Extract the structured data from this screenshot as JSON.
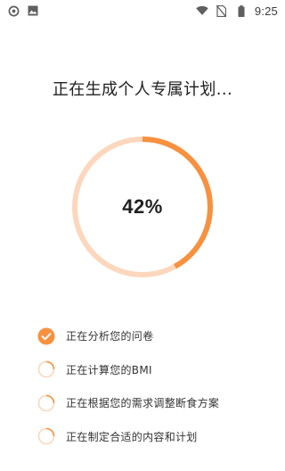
{
  "status_bar": {
    "time": "9:25",
    "left_icons": [
      "target-icon",
      "image-icon"
    ],
    "right_icons": [
      "wifi-icon",
      "sim-no-signal-icon",
      "battery-icon"
    ]
  },
  "title": "正在生成个人专属计划...",
  "progress": {
    "value": 42,
    "label": "42%",
    "track_color": "#fcd7bd",
    "fill_color": "#f7913f"
  },
  "steps": [
    {
      "label": "正在分析您的问卷",
      "status": "done"
    },
    {
      "label": "正在计算您的BMI",
      "status": "pending"
    },
    {
      "label": "正在根据您的需求调整断食方案",
      "status": "pending"
    },
    {
      "label": "正在制定合适的内容和计划",
      "status": "pending"
    }
  ],
  "colors": {
    "accent": "#f7913f",
    "accent_light": "#fcd7bd"
  }
}
